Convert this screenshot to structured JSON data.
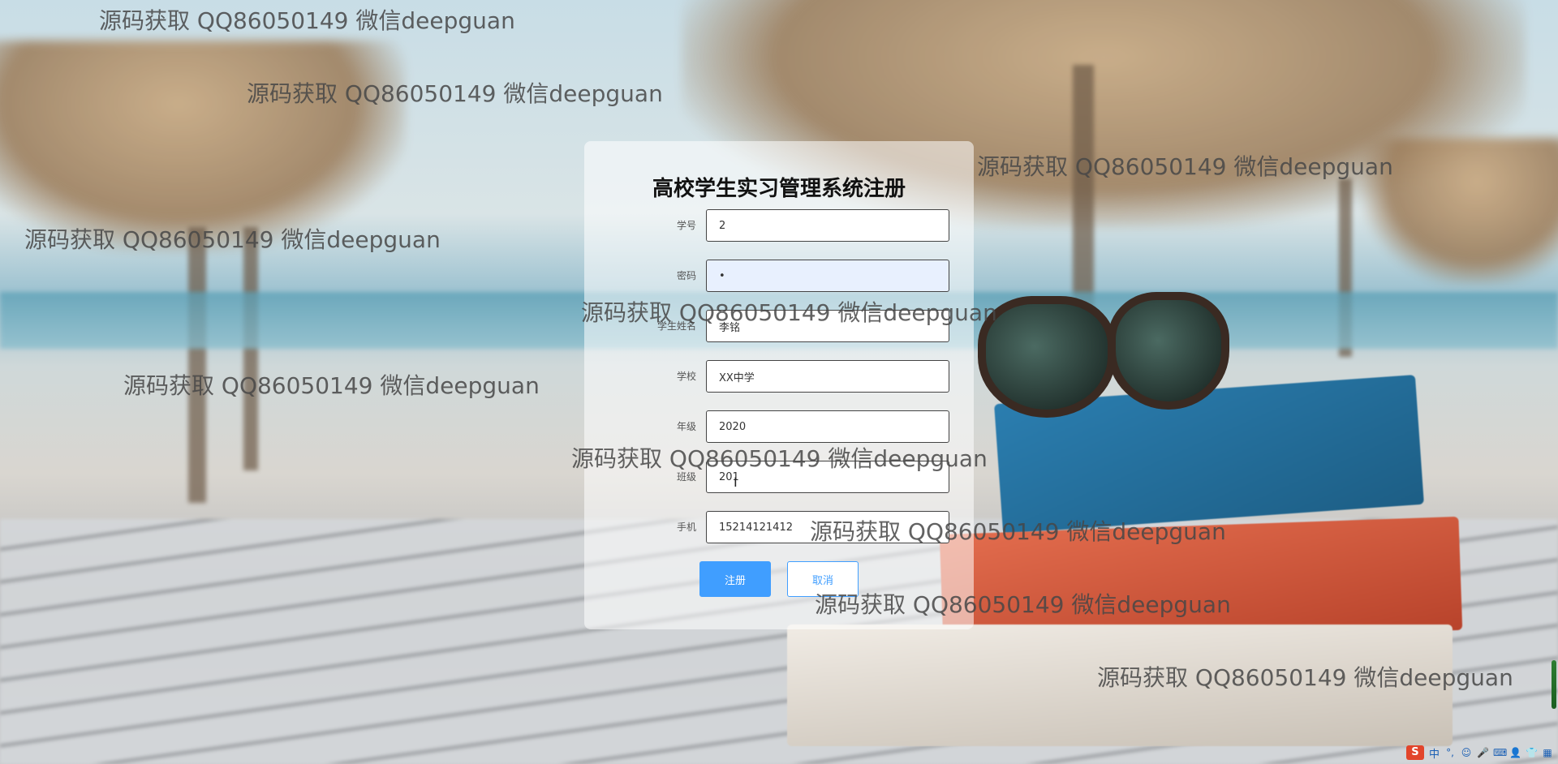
{
  "form": {
    "title": "高校学生实习管理系统注册",
    "fields": [
      {
        "label": "学号",
        "value": "2"
      },
      {
        "label": "密码",
        "value": "•"
      },
      {
        "label": "学生姓名",
        "value": "李铭"
      },
      {
        "label": "学校",
        "value": "XX中学"
      },
      {
        "label": "年级",
        "value": "2020"
      },
      {
        "label": "班级",
        "value": "201"
      },
      {
        "label": "手机",
        "value": "15214121412"
      }
    ],
    "register_label": "注册",
    "cancel_label": "取消"
  },
  "watermark_text": "源码获取 QQ86050149 微信deepguan",
  "taskbar": {
    "ime_logo": "S",
    "ime_mode": "中",
    "icons": [
      "punctuation-icon",
      "emoji-icon",
      "microphone-icon",
      "keyboard-icon",
      "user-icon",
      "shirt-icon",
      "grid-icon"
    ]
  },
  "colors": {
    "primary": "#409eff",
    "autofill": "#e8f0fe"
  }
}
